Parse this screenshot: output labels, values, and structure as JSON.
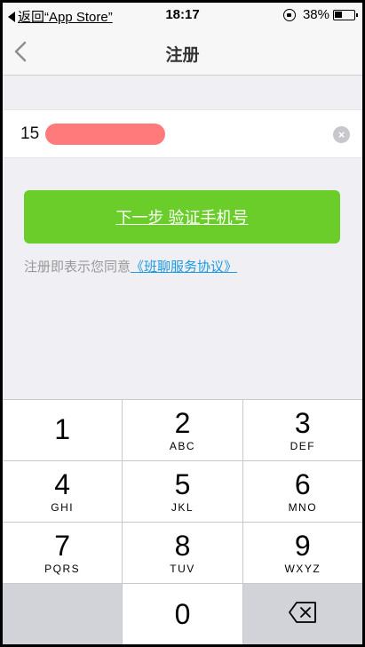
{
  "status_bar": {
    "back_label": "返回“App Store”",
    "time": "18:17",
    "battery": "38%"
  },
  "nav": {
    "title": "注册"
  },
  "phone": {
    "value": "15"
  },
  "next_button": {
    "label": "下一步 验证手机号"
  },
  "agreement": {
    "prefix": "注册即表示您同意",
    "link": "《班聊服务协议》"
  },
  "keypad": {
    "keys": [
      {
        "num": "1",
        "letters": ""
      },
      {
        "num": "2",
        "letters": "ABC"
      },
      {
        "num": "3",
        "letters": "DEF"
      },
      {
        "num": "4",
        "letters": "GHI"
      },
      {
        "num": "5",
        "letters": "JKL"
      },
      {
        "num": "6",
        "letters": "MNO"
      },
      {
        "num": "7",
        "letters": "PQRS"
      },
      {
        "num": "8",
        "letters": "TUV"
      },
      {
        "num": "9",
        "letters": "WXYZ"
      },
      {
        "num": "0",
        "letters": ""
      }
    ]
  },
  "colors": {
    "accent": "#6acd2a",
    "link": "#1e9be0"
  }
}
